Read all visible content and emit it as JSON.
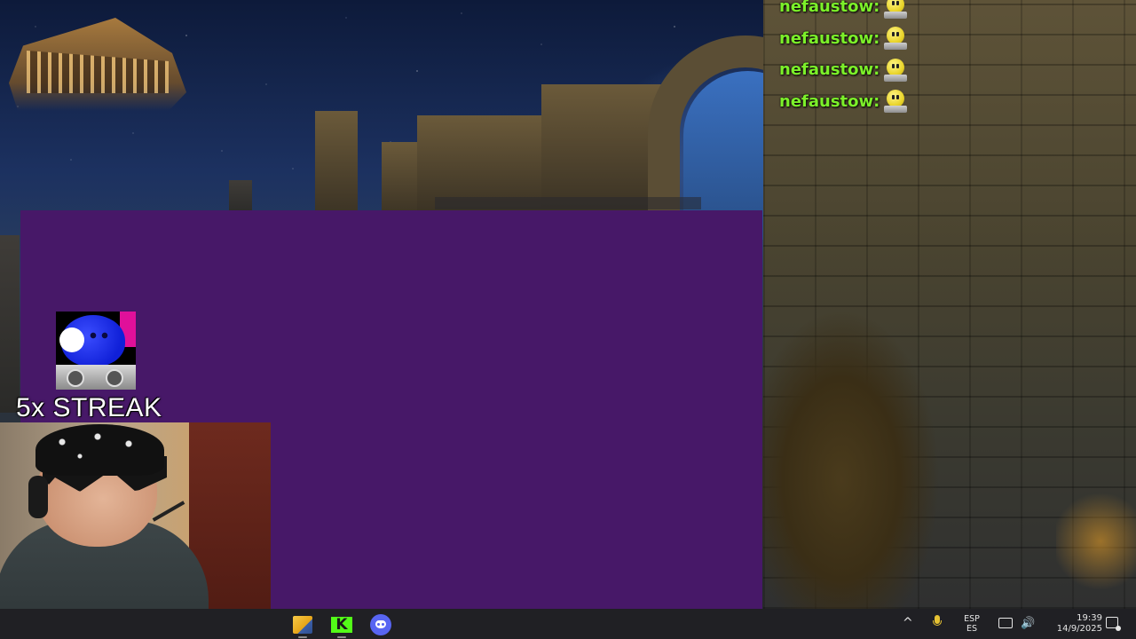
{
  "chat": {
    "messages": [
      {
        "username": "nefaustow:",
        "emote": "smiley-dj-emote"
      },
      {
        "username": "nefaustow:",
        "emote": "smiley-dj-emote"
      },
      {
        "username": "nefaustow:",
        "emote": "smiley-dj-emote"
      },
      {
        "username": "nefaustow:",
        "emote": "smiley-dj-emote"
      }
    ],
    "username_color": "#7cf02a"
  },
  "overlay": {
    "streak_text": "5x STREAK",
    "streak_icon": "blue-robot-dj-icon"
  },
  "window": {
    "background_color": "#471868"
  },
  "taskbar": {
    "apps": [
      {
        "name": "file-explorer",
        "icon": "file-explorer-icon"
      },
      {
        "name": "kick",
        "icon": "kick-icon",
        "glyph": "K"
      },
      {
        "name": "discord",
        "icon": "discord-icon"
      }
    ],
    "tray": {
      "chevron": "^",
      "language_primary": "ESP",
      "language_secondary": "ES",
      "volume_glyph": "🔊",
      "time": "19:39",
      "date": "14/9/2025"
    }
  }
}
